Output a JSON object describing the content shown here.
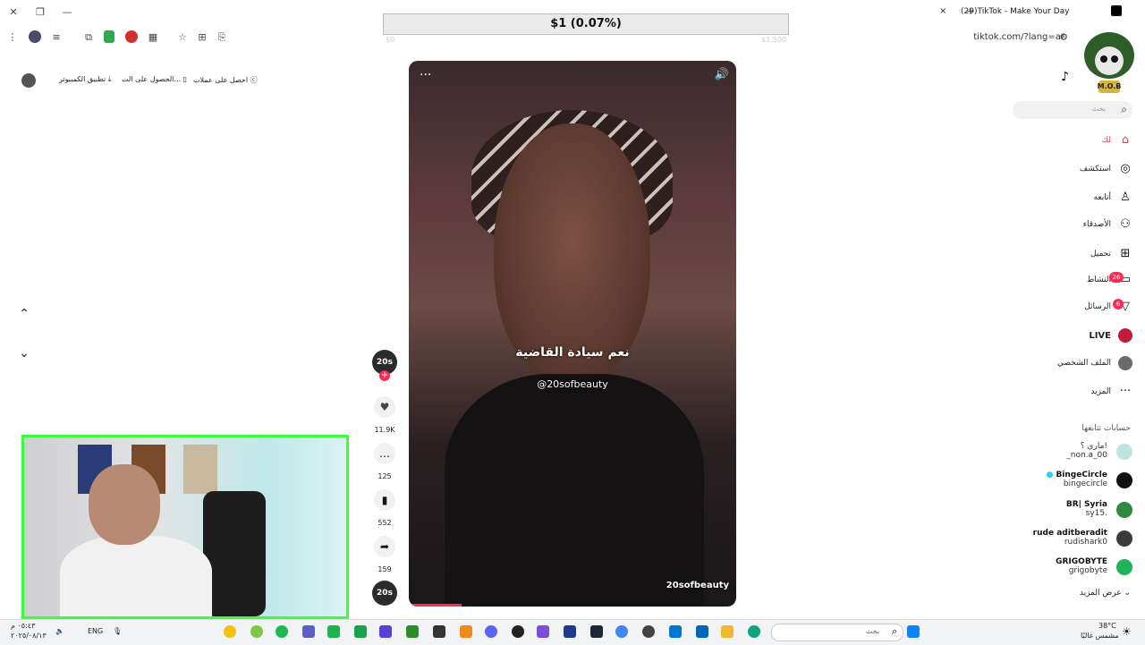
{
  "browser": {
    "tab_title": "(29)TikTok - Make Your Day",
    "url": "tiktok.com/?lang=ar",
    "new_tab": "+",
    "close_tab": "×"
  },
  "donation": {
    "amount": "$1 (0.07%)",
    "left_label": "$0",
    "right_label": "$1,500"
  },
  "toplinks": [
    {
      "label": "احصل على عملات"
    },
    {
      "label": "الحصول على الت..."
    },
    {
      "label": "تطبيق الكمبيوتر"
    }
  ],
  "video": {
    "caption": "نعم سيادة القاضية",
    "handle": "@20sofbeauty",
    "watermark": "20sofbeauty",
    "progress": 0.16
  },
  "actions": {
    "avatar_label": "20s",
    "likes": "11.9K",
    "comments": "125",
    "saves": "552",
    "shares": "159"
  },
  "sidebar": {
    "search_placeholder": "بحث",
    "items": [
      {
        "label": "لك",
        "icon": "home-icon",
        "active": true
      },
      {
        "label": "استكشف",
        "icon": "compass-icon"
      },
      {
        "label": "أتابعه",
        "icon": "following-icon"
      },
      {
        "label": "الأصدقاء",
        "icon": "friends-icon"
      },
      {
        "label": "تحميل",
        "icon": "upload-icon"
      },
      {
        "label": "النشاط",
        "icon": "activity-icon",
        "badge": "26"
      },
      {
        "label": "الرسائل",
        "icon": "messages-icon",
        "badge": "6"
      },
      {
        "label": "LIVE",
        "icon": "live-icon"
      },
      {
        "label": "الملف الشخصي",
        "icon": "profile-icon"
      },
      {
        "label": "المزيد",
        "icon": "more-icon"
      }
    ],
    "following_title": "حسابات تتابعها",
    "accounts": [
      {
        "name": "ماري ؟!",
        "handle": "_non.a_00",
        "color": "#bfe3e0"
      },
      {
        "name": "BingeCircle",
        "handle": "bingecircle",
        "color": "#111111"
      },
      {
        "name": "BR| Syria",
        "handle": "sy15.",
        "color": "#2e8b3d"
      },
      {
        "name": "rude aditberadit",
        "handle": "rudishark0",
        "color": "#3a3a3a"
      },
      {
        "name": "GRIGOBYTE",
        "handle": "grigobyte",
        "color": "#1fb35a"
      }
    ],
    "see_more": "عرض المزيد"
  },
  "logo_text": "M.O.B",
  "taskbar": {
    "time": "٠٥:٤٣ م",
    "date": "٢٠٢٥/٠٨/١٣",
    "lang": "ENG",
    "search_placeholder": "بحث",
    "temperature": "38°C",
    "weather": "مشمس غالبًا"
  },
  "colors": {
    "accent": "#fe2c55",
    "webcam_border": "#3cff3c"
  }
}
